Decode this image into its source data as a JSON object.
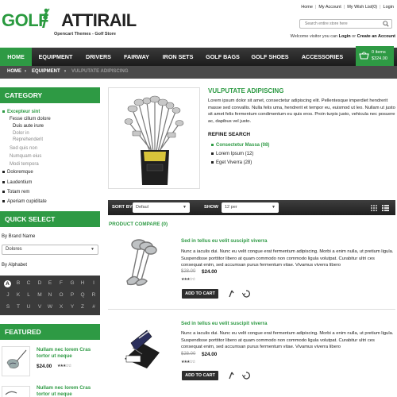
{
  "header": {
    "logo_part1": "GOLF",
    "logo_part2": "ATTIRAIL",
    "logo_sub": "Opencart Themes - Golf Store",
    "toplinks": [
      "Home",
      "My Account",
      "My Wish List(0)",
      "Login"
    ],
    "search_placeholder": "Search entire store here",
    "welcome_pre": "Welcome visitor you can",
    "welcome_login": "Login",
    "welcome_or": "or",
    "welcome_create": "Create an Account"
  },
  "nav": {
    "items": [
      "HOME",
      "EQUIPMENT",
      "DRIVERS",
      "FAIRWAY",
      "IRON SETS",
      "GOLF BAGS",
      "GOLF SHOES",
      "ACCESSORIES"
    ],
    "active": "HOME"
  },
  "cart": {
    "items": "0 items",
    "total": "$324.00"
  },
  "breadcrumb": [
    "HOME",
    "EQUIPMENT",
    "VULPUTATE ADIPISCING"
  ],
  "sidebar": {
    "category_title": "CATEGORY",
    "categories": [
      {
        "label": "Excepteur sint",
        "style": "green-bullet"
      },
      {
        "label": "Fesse cillum dolore",
        "style": "sub"
      },
      {
        "label": "Duis aute irure",
        "style": "sub2"
      },
      {
        "label": "Dolor in",
        "style": "grey"
      },
      {
        "label": "Reprehenderit",
        "style": "grey"
      },
      {
        "label": "Sed quis non",
        "style": "grey"
      },
      {
        "label": "Numquam eius",
        "style": "grey"
      },
      {
        "label": "Modi tempora",
        "style": "grey"
      },
      {
        "label": "Doloremque",
        "style": "bullet"
      },
      {
        "label": "Laudentium",
        "style": "bullet"
      },
      {
        "label": "Totam rem",
        "style": "bullet"
      },
      {
        "label": "Aperiam cupiditate",
        "style": "bullet"
      }
    ],
    "quick_select_title": "QUICK SELECT",
    "by_brand_label": "By Brand Name",
    "brand_value": "Dolores",
    "by_alphabet_label": "By Alphabet",
    "alphabet": [
      "A",
      "B",
      "C",
      "D",
      "E",
      "F",
      "G",
      "H",
      "I",
      "J",
      "K",
      "L",
      "M",
      "N",
      "O",
      "P",
      "Q",
      "R",
      "S",
      "T",
      "U",
      "V",
      "W",
      "X",
      "Y",
      "Z",
      "#"
    ],
    "featured_title": "FEATURED",
    "featured": [
      {
        "title": "Nullam nec lorem Cras tortor ut neque",
        "price": "$24.00"
      },
      {
        "title": "Nullam nec lorem Cras tortor ut neque",
        "price": ""
      }
    ]
  },
  "product": {
    "title": "VULPUTATE ADIPISCING",
    "description": "Lorem ipsum dolor sit amet, consectetur adipiscing elit. Pellentesque imperdiet hendrerit masse sed convallis. Nulla felis uma, hendrerit et tempor eu, euismod ut leo. Nullam ut justo sit amet felis fermentum condimentum eu quis eros. Proin turpis justo, vehicula nec posuere ac, dapibus vel justo.",
    "refine_title": "REFINE SEARCH",
    "refine": [
      {
        "label": "Consectetur Massa (08)",
        "active": true
      },
      {
        "label": "Lorem Ipsum (12)",
        "active": false
      },
      {
        "label": "Eget Viverra (28)",
        "active": false
      }
    ]
  },
  "sortbar": {
    "sort_label": "SORT BY",
    "sort_value": "Defaul",
    "show_label": "SHOW",
    "show_value": "12 per"
  },
  "compare_label": "PRODUCT COMPARE (0)",
  "listing": [
    {
      "title": "Sed in tellus eu velit suscipit viverra",
      "description": "Nunc a iaculis dui. Nunc eu velit congue erat fermentum adipiscing. Morbi a enim nulla, ut pretium ligula. Suspendisse porttitor libero at quam commodo non commodo ligula volutpat. Curabitur ultri ces consequat enim, sed accumsan purus fermentum vitae. Vivamus viverra libero",
      "old_price": "$28.00",
      "price": "$24.00",
      "add_label": "ADD TO CART"
    },
    {
      "title": "Sed in tellus eu velit suscipit viverra",
      "description": "Nunc a iaculis dui. Nunc eu velit congue erat fermentum adipiscing. Morbi a enim nulla, ut pretium ligula. Suspendisse porttitor libero at quam commodo non commodo ligula volutpat. Curabitur ultri ces consequat enim, sed accumsan purus fermentum vitae. Vivamus viverra libero",
      "old_price": "$28.00",
      "price": "$24.00",
      "add_label": "ADD TO CART"
    }
  ],
  "colors": {
    "accent": "#2e9a44",
    "nav": "#2a2a2a",
    "breadcrumb": "#4a4a4a"
  },
  "icons": [
    "golfer-logo-icon",
    "search-icon",
    "cart-icon",
    "grid-view-icon",
    "list-view-icon",
    "compare-icon",
    "wishlist-icon",
    "chevron-right-icon"
  ]
}
